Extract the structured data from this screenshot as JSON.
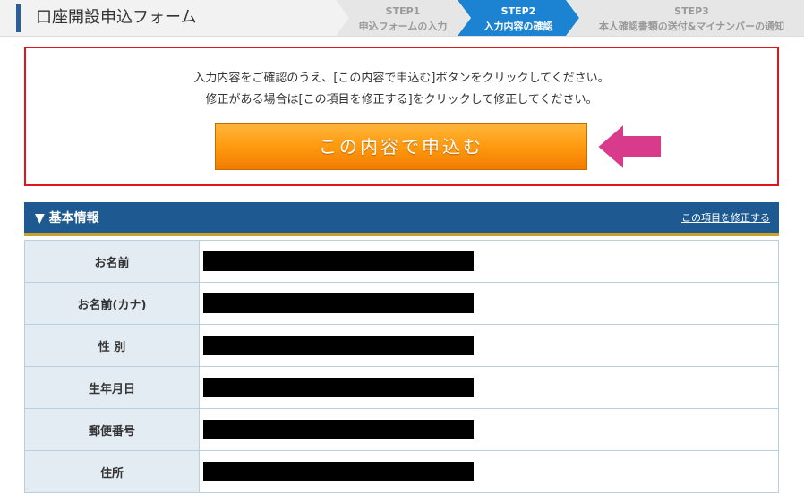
{
  "header": {
    "title": "口座開設申込フォーム",
    "steps": [
      {
        "label": "STEP1",
        "sub": "申込フォームの入力",
        "active": false
      },
      {
        "label": "STEP2",
        "sub": "入力内容の確認",
        "active": true
      },
      {
        "label": "STEP3",
        "sub": "本人確認書類の送付&マイナンバーの通知",
        "active": false
      }
    ]
  },
  "confirm": {
    "line1": "入力内容をご確認のうえ、[この内容で申込む]ボタンをクリックしてください。",
    "line2": "修正がある場合は[この項目を修正する]をクリックして修正してください。",
    "submit_label": "この内容で申込む"
  },
  "section": {
    "title": "▼ 基本情報",
    "edit_link": "この項目を修正する",
    "rows": [
      {
        "label": "お名前"
      },
      {
        "label": "お名前(カナ)"
      },
      {
        "label": "性 別"
      },
      {
        "label": "生年月日"
      },
      {
        "label": "郵便番号"
      },
      {
        "label": "住所"
      }
    ]
  },
  "colors": {
    "brand_blue": "#1e5a91",
    "active_step": "#1b83d2",
    "submit_orange": "#ff9a10",
    "arrow_pink": "#d83a8c",
    "alert_red": "#e0151d"
  }
}
